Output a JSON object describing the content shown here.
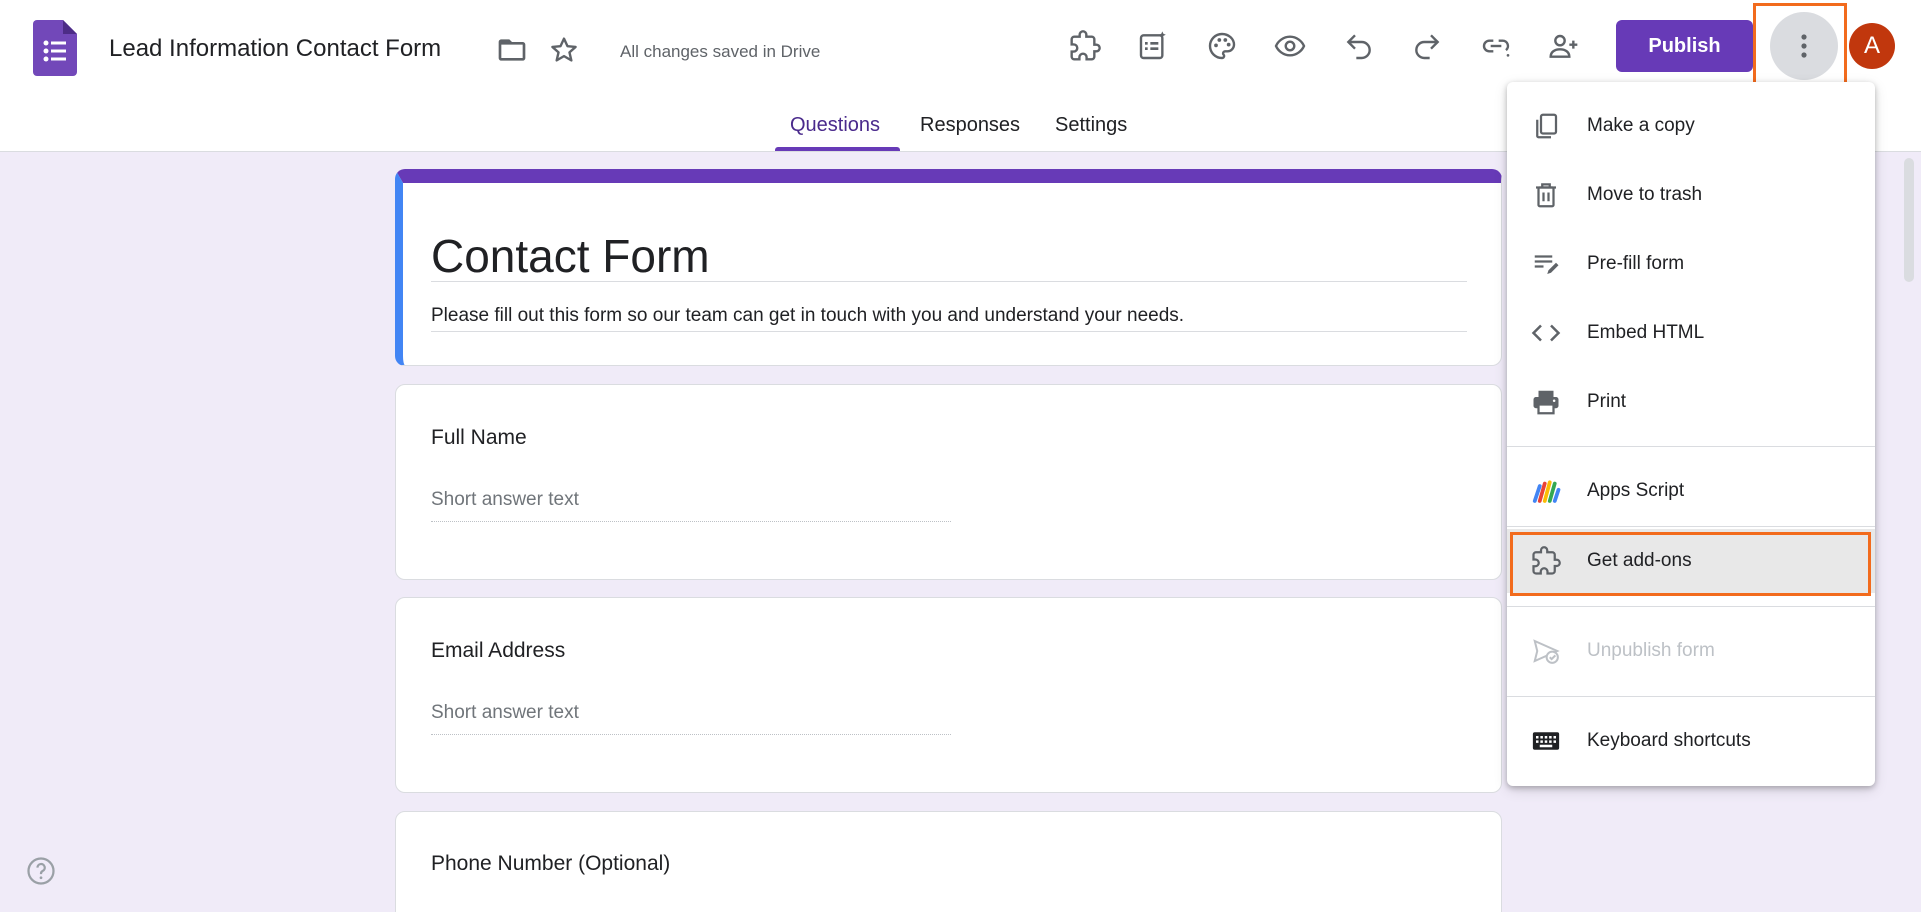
{
  "header": {
    "doc_title": "Lead Information Contact Form",
    "save_status": "All changes saved in Drive",
    "publish_label": "Publish",
    "avatar_letter": "A",
    "toolbar_icons": [
      "addons-icon",
      "ai-form-icon",
      "palette-icon",
      "preview-icon",
      "undo-icon",
      "redo-icon",
      "link-icon",
      "add-collaborator-icon",
      "more-vert-icon"
    ]
  },
  "tabs": [
    {
      "label": "Questions",
      "active": true
    },
    {
      "label": "Responses",
      "active": false
    },
    {
      "label": "Settings",
      "active": false
    }
  ],
  "form": {
    "title": "Contact Form",
    "description": "Please fill out this form so our team can get in touch with you and understand your needs.",
    "questions": [
      {
        "title": "Full Name",
        "placeholder": "Short answer text"
      },
      {
        "title": "Email Address",
        "placeholder": "Short answer text"
      },
      {
        "title": "Phone Number (Optional)"
      }
    ]
  },
  "menu": {
    "items": [
      {
        "label": "Make a copy",
        "icon": "copy-icon"
      },
      {
        "label": "Move to trash",
        "icon": "trash-icon"
      },
      {
        "label": "Pre-fill form",
        "icon": "prefill-icon"
      },
      {
        "label": "Embed HTML",
        "icon": "code-icon"
      },
      {
        "label": "Print",
        "icon": "print-icon"
      },
      {
        "label": "Apps Script",
        "icon": "apps-script-icon"
      },
      {
        "label": "Get add-ons",
        "icon": "addons-icon",
        "highlighted": true
      },
      {
        "label": "Unpublish form",
        "icon": "unpublish-icon",
        "disabled": true
      },
      {
        "label": "Keyboard shortcuts",
        "icon": "keyboard-icon"
      }
    ]
  },
  "colors": {
    "brand": "#673ab7",
    "highlight": "#f26b1d",
    "avatar": "#c1370d",
    "background": "#f0ebf8"
  }
}
